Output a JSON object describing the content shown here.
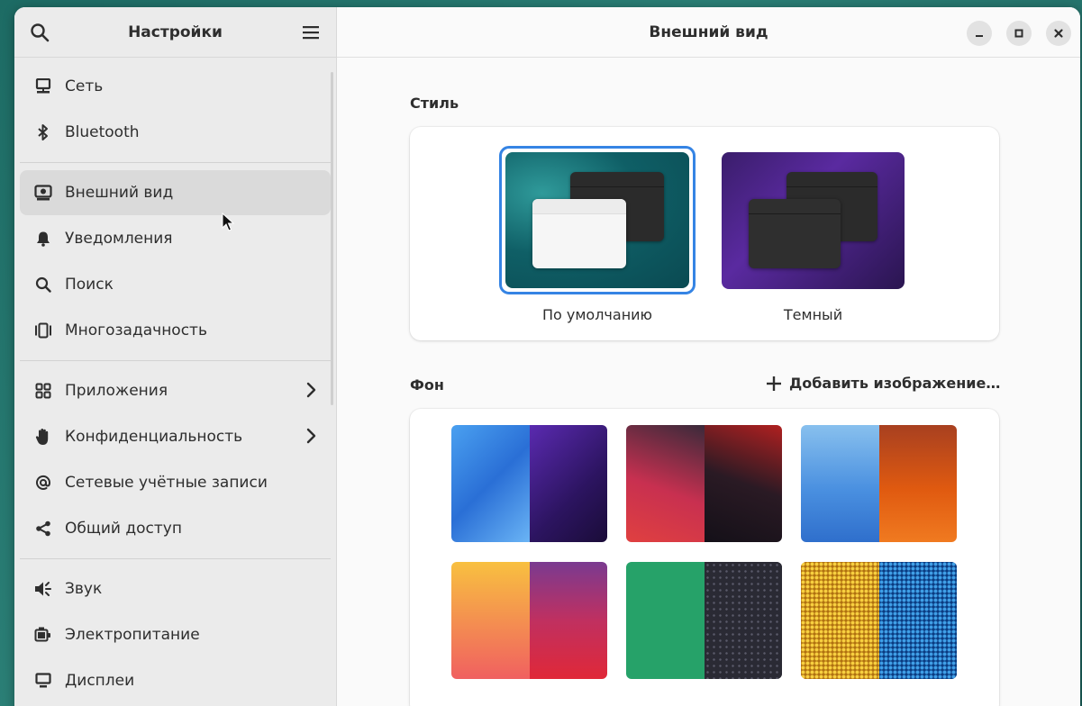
{
  "sidebar": {
    "title": "Настройки",
    "groups": [
      [
        {
          "label": "Сеть",
          "icon": "network-icon"
        },
        {
          "label": "Bluetooth",
          "icon": "bluetooth-icon"
        }
      ],
      [
        {
          "label": "Внешний вид",
          "icon": "appearance-icon",
          "active": true
        },
        {
          "label": "Уведомления",
          "icon": "bell-icon"
        },
        {
          "label": "Поиск",
          "icon": "search-icon"
        },
        {
          "label": "Многозадачность",
          "icon": "multitasking-icon"
        }
      ],
      [
        {
          "label": "Приложения",
          "icon": "apps-icon",
          "chevron": true
        },
        {
          "label": "Конфиденциальность",
          "icon": "hand-icon",
          "chevron": true
        },
        {
          "label": "Сетевые учётные записи",
          "icon": "at-icon"
        },
        {
          "label": "Общий доступ",
          "icon": "share-icon"
        }
      ],
      [
        {
          "label": "Звук",
          "icon": "speaker-icon"
        },
        {
          "label": "Электропитание",
          "icon": "power-icon"
        },
        {
          "label": "Дисплеи",
          "icon": "display-icon"
        }
      ]
    ]
  },
  "main": {
    "title": "Внешний вид",
    "style_label": "Стиль",
    "styles": [
      {
        "label": "По умолчанию",
        "selected": true
      },
      {
        "label": "Темный",
        "selected": false
      }
    ],
    "background_label": "Фон",
    "add_image_label": "Добавить изображение…"
  },
  "colors": {
    "accent": "#3584e4",
    "sidebar_bg": "#ebebeb",
    "main_bg": "#fafafa"
  }
}
